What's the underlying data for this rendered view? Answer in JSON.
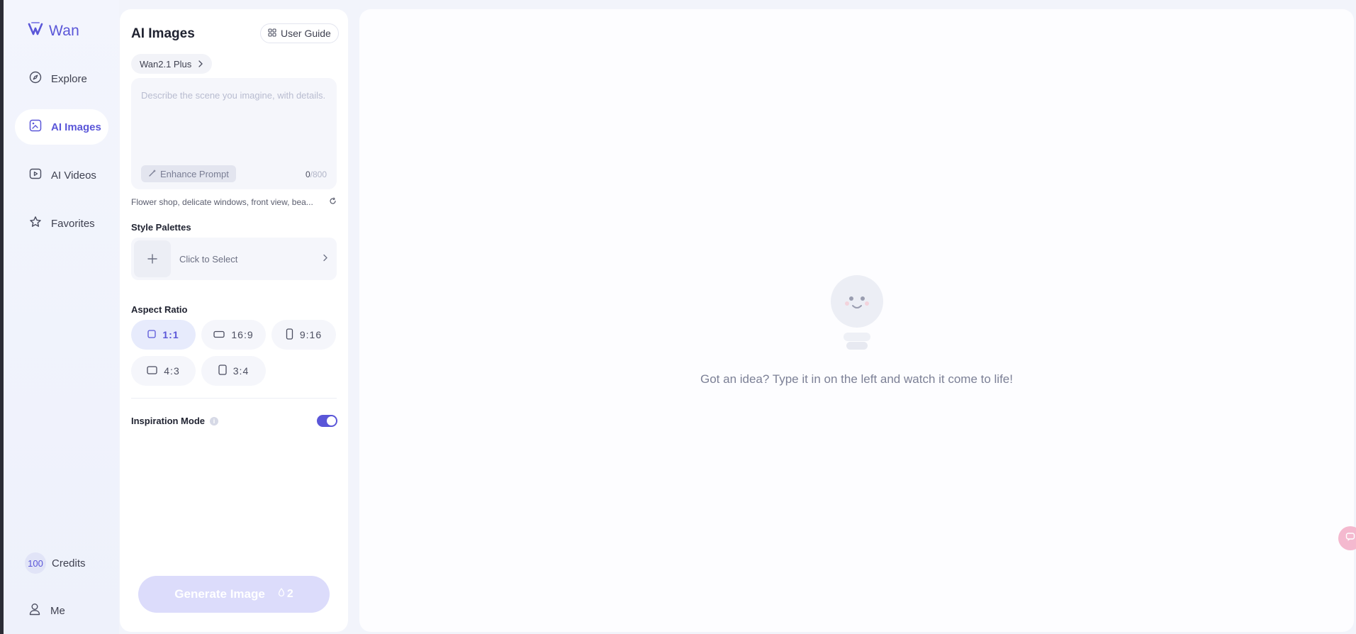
{
  "app": {
    "logo_text": "Wan"
  },
  "sidebar": {
    "items": [
      {
        "label": "Explore",
        "icon": "compass-icon",
        "active": false
      },
      {
        "label": "AI Images",
        "icon": "image-icon",
        "active": true
      },
      {
        "label": "AI Videos",
        "icon": "video-icon",
        "active": false
      },
      {
        "label": "Favorites",
        "icon": "star-icon",
        "active": false
      }
    ],
    "credits_count": "100",
    "credits_label": "Credits",
    "me_label": "Me"
  },
  "panel": {
    "title": "AI Images",
    "guide_label": "User Guide",
    "model_label": "Wan2.1 Plus",
    "prompt_value": "",
    "prompt_placeholder": "Describe the scene you imagine, with details.",
    "enhance_label": "Enhance Prompt",
    "counter_current": "0",
    "counter_max": "/800",
    "suggestion": "Flower shop, delicate windows, front view, bea...",
    "style_label": "Style Palettes",
    "style_select_label": "Click to Select",
    "aspect_label": "Aspect Ratio",
    "ratios": [
      {
        "label": "1:1",
        "active": true
      },
      {
        "label": "16:9",
        "active": false
      },
      {
        "label": "9:16",
        "active": false
      },
      {
        "label": "4:3",
        "active": false
      },
      {
        "label": "3:4",
        "active": false
      }
    ],
    "inspiration_label": "Inspiration Mode",
    "inspiration_on": true,
    "generate_label": "Generate Image",
    "generate_cost": "2"
  },
  "main": {
    "empty_message": "Got an idea? Type it in on the left and watch it come to life!"
  },
  "colors": {
    "accent": "#5a56d8",
    "page_bg": "#f2f4fb",
    "panel_bg": "#ffffff",
    "generate_disabled": "#dcdcfb"
  }
}
